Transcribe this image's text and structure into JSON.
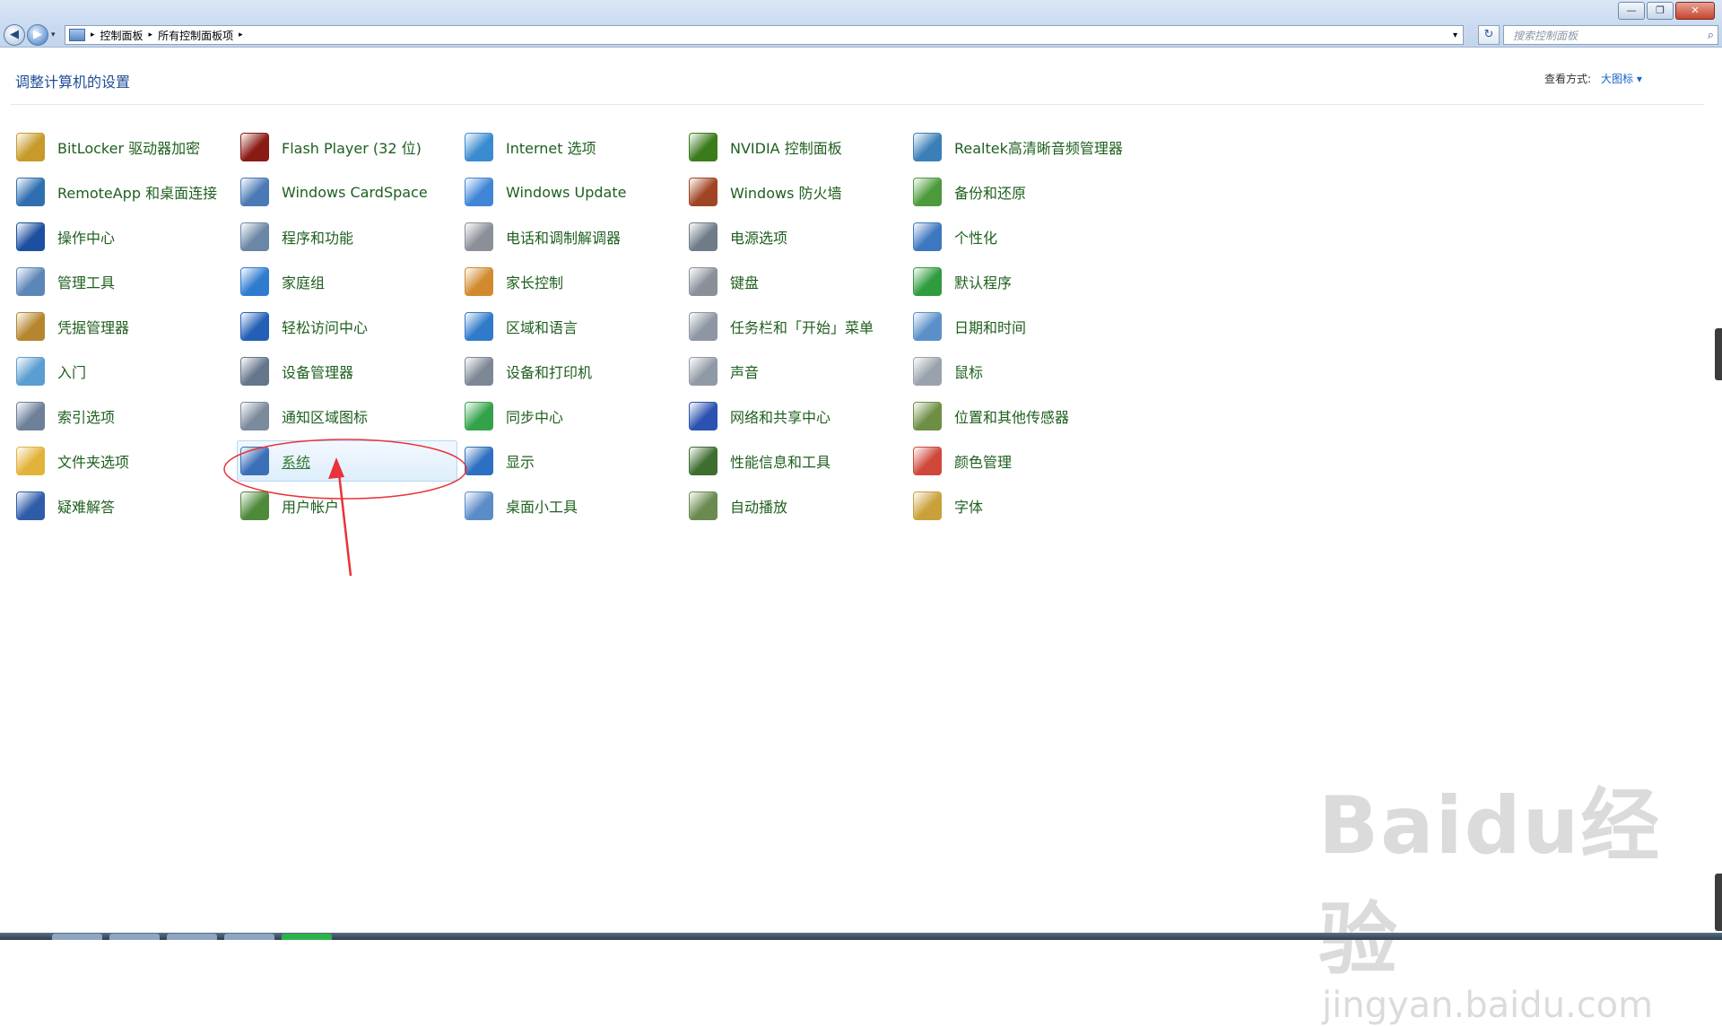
{
  "window": {
    "controls": {
      "minimize": "—",
      "maximize": "❐",
      "close": "✕"
    }
  },
  "nav": {
    "back": "◀",
    "forward": "▶",
    "history": "▾"
  },
  "address_bar": {
    "crumbs": [
      "控制面板",
      "所有控制面板项"
    ],
    "separator": "▸",
    "dropdown": "▾",
    "refresh": "↻"
  },
  "search": {
    "placeholder": "搜索控制面板",
    "icon": "⌕"
  },
  "header": {
    "title": "调整计算机的设置",
    "view_by_label": "查看方式:",
    "view_by_value": "大图标 ▾"
  },
  "items": [
    [
      "BitLocker 驱动器加密",
      "RemoteApp 和桌面连接",
      "操作中心",
      "管理工具",
      "凭据管理器",
      "入门",
      "索引选项",
      "文件夹选项",
      "疑难解答"
    ],
    [
      "Flash Player (32 位)",
      "Windows CardSpace",
      "程序和功能",
      "家庭组",
      "轻松访问中心",
      "设备管理器",
      "通知区域图标",
      "系统",
      "用户帐户"
    ],
    [
      "Internet 选项",
      "Windows Update",
      "电话和调制解调器",
      "家长控制",
      "区域和语言",
      "设备和打印机",
      "同步中心",
      "显示",
      "桌面小工具"
    ],
    [
      "NVIDIA 控制面板",
      "Windows 防火墙",
      "电源选项",
      "键盘",
      "任务栏和「开始」菜单",
      "声音",
      "网络和共享中心",
      "性能信息和工具",
      "自动播放"
    ],
    [
      "Realtek高清晰音频管理器",
      "备份和还原",
      "个性化",
      "默认程序",
      "日期和时间",
      "鼠标",
      "位置和其他传感器",
      "颜色管理",
      "字体"
    ]
  ],
  "selected_item": "系统",
  "watermark": {
    "main": "Baidu经验",
    "sub": "jingyan.baidu.com"
  },
  "colors": {
    "item_text": "#1e5f1e",
    "heading": "#1e4d96",
    "annotation": "#e8333a"
  }
}
